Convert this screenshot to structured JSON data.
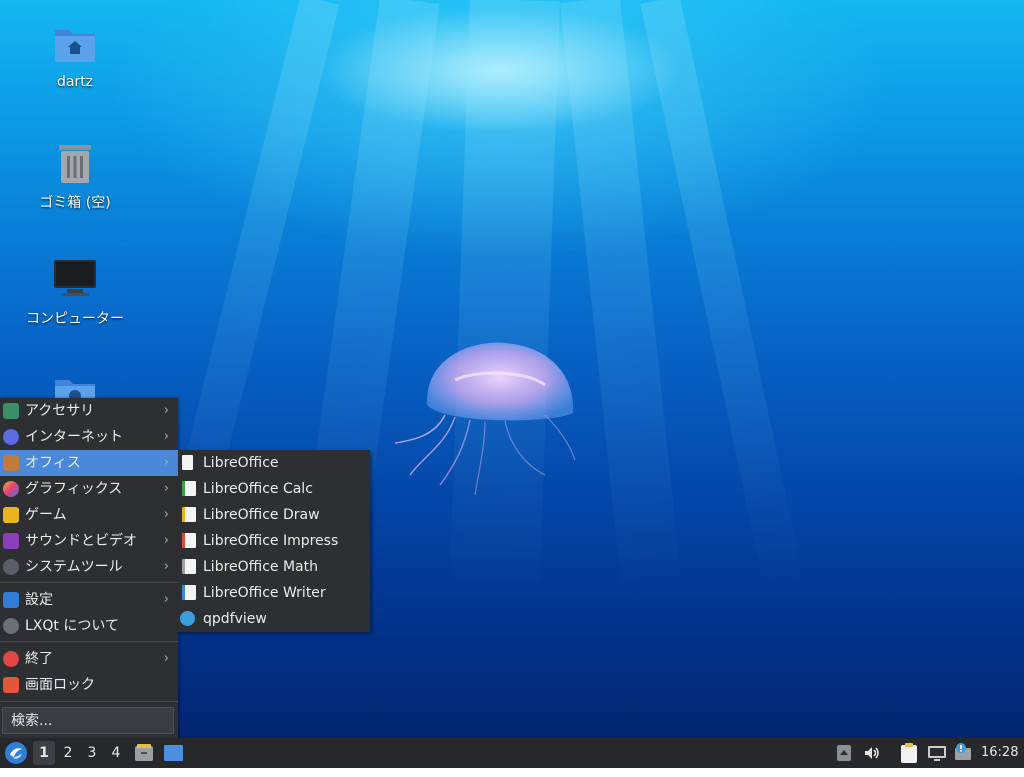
{
  "desktop": {
    "icons": [
      {
        "label": "dartz",
        "icon": "home-folder-icon"
      },
      {
        "label": "ゴミ箱 (空)",
        "icon": "trash-icon"
      },
      {
        "label": "コンピューター",
        "icon": "computer-icon"
      },
      {
        "label": "",
        "icon": "network-folder-icon"
      }
    ]
  },
  "start_menu": {
    "items": [
      {
        "label": "アクセサリ",
        "icon": "accessories-icon",
        "arrow": "›"
      },
      {
        "label": "インターネット",
        "icon": "internet-icon",
        "arrow": "›"
      },
      {
        "label": "オフィス",
        "icon": "office-icon",
        "arrow": "›"
      },
      {
        "label": "グラフィックス",
        "icon": "graphics-icon",
        "arrow": "›"
      },
      {
        "label": "ゲーム",
        "icon": "games-icon",
        "arrow": "›"
      },
      {
        "label": "サウンドとビデオ",
        "icon": "multimedia-icon",
        "arrow": "›"
      },
      {
        "label": "システムツール",
        "icon": "system-tools-icon",
        "arrow": "›"
      },
      {
        "label": "設定",
        "icon": "settings-icon",
        "arrow": "›"
      },
      {
        "label": "LXQt について",
        "icon": "info-icon",
        "arrow": ""
      },
      {
        "label": "終了",
        "icon": "power-icon",
        "arrow": "›"
      },
      {
        "label": "画面ロック",
        "icon": "lock-icon",
        "arrow": ""
      }
    ],
    "active_index": 2,
    "search_placeholder": "検索..."
  },
  "office_submenu": {
    "items": [
      {
        "label": "LibreOffice",
        "icon": "libreoffice-icon"
      },
      {
        "label": "LibreOffice Calc",
        "icon": "libreoffice-calc-icon"
      },
      {
        "label": "LibreOffice Draw",
        "icon": "libreoffice-draw-icon"
      },
      {
        "label": "LibreOffice Impress",
        "icon": "libreoffice-impress-icon"
      },
      {
        "label": "LibreOffice Math",
        "icon": "libreoffice-math-icon"
      },
      {
        "label": "LibreOffice Writer",
        "icon": "libreoffice-writer-icon"
      },
      {
        "label": "qpdfview",
        "icon": "qpdfview-icon"
      }
    ]
  },
  "taskbar": {
    "desktops": [
      "1",
      "2",
      "3",
      "4"
    ],
    "active_desktop": "1",
    "clock": "16:28",
    "tray_icons": [
      "tray-up-arrow-icon",
      "volume-icon",
      "clipboard-icon",
      "network-icon",
      "update-notifier-icon"
    ],
    "quicklaunch": [
      "file-manager-icon",
      "show-desktop-icon"
    ]
  },
  "colors": {
    "menu_bg": "#2d2f33",
    "menu_highlight": "#4b89d8",
    "taskbar_bg": "#26282c"
  }
}
